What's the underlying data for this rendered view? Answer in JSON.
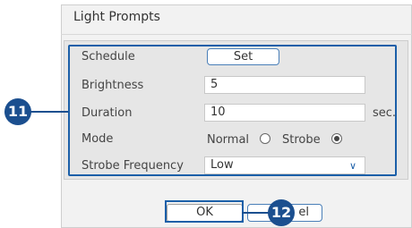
{
  "dialog": {
    "title": "Light Prompts",
    "schedule": {
      "label": "Schedule",
      "button_label": "Set"
    },
    "brightness": {
      "label": "Brightness",
      "value": "5"
    },
    "duration": {
      "label": "Duration",
      "value": "10",
      "unit": "sec."
    },
    "mode": {
      "label": "Mode",
      "options": [
        {
          "label": "Normal",
          "selected": false
        },
        {
          "label": "Strobe",
          "selected": true
        }
      ]
    },
    "strobe_frequency": {
      "label": "Strobe Frequency",
      "value": "Low"
    },
    "buttons": {
      "ok": "OK",
      "cancel_visible": "el"
    }
  },
  "callouts": {
    "first": "11",
    "second": "12"
  },
  "colors": {
    "highlight": "#1b5fa8",
    "callout": "#1b4f8f",
    "panel": "#e6e6e6"
  },
  "icons": {
    "select_chevron": "chevron-down-icon"
  }
}
